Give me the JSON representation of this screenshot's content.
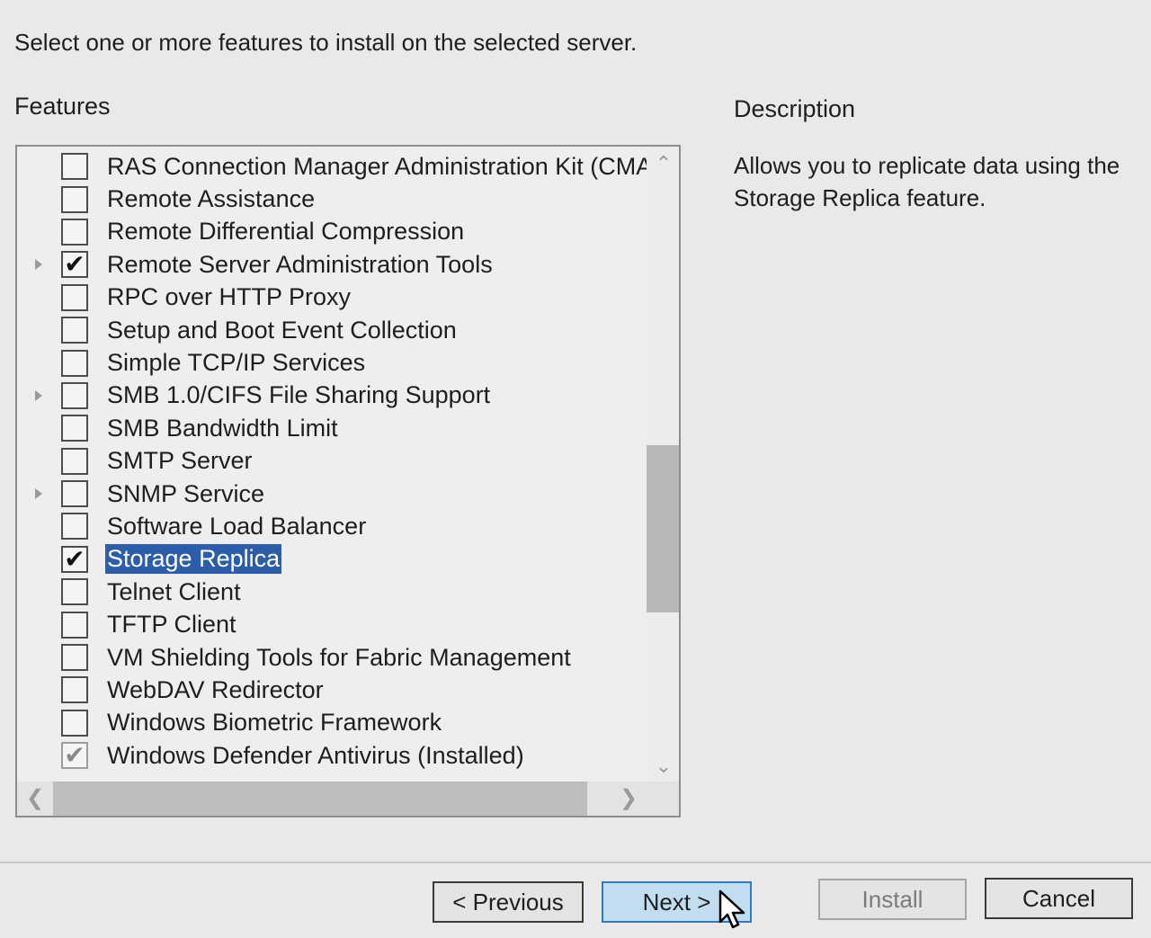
{
  "instruction": "Select one or more features to install on the selected server.",
  "features_label": "Features",
  "description": {
    "label": "Description",
    "text": "Allows you to replicate data using the Storage Replica feature."
  },
  "features": [
    {
      "label": "RAS Connection Manager Administration Kit (CMA",
      "checked": false,
      "expandable": false,
      "selected": false,
      "installed": false
    },
    {
      "label": "Remote Assistance",
      "checked": false,
      "expandable": false,
      "selected": false,
      "installed": false
    },
    {
      "label": "Remote Differential Compression",
      "checked": false,
      "expandable": false,
      "selected": false,
      "installed": false
    },
    {
      "label": "Remote Server Administration Tools",
      "checked": true,
      "expandable": true,
      "selected": false,
      "installed": false
    },
    {
      "label": "RPC over HTTP Proxy",
      "checked": false,
      "expandable": false,
      "selected": false,
      "installed": false
    },
    {
      "label": "Setup and Boot Event Collection",
      "checked": false,
      "expandable": false,
      "selected": false,
      "installed": false
    },
    {
      "label": "Simple TCP/IP Services",
      "checked": false,
      "expandable": false,
      "selected": false,
      "installed": false
    },
    {
      "label": "SMB 1.0/CIFS File Sharing Support",
      "checked": false,
      "expandable": true,
      "selected": false,
      "installed": false
    },
    {
      "label": "SMB Bandwidth Limit",
      "checked": false,
      "expandable": false,
      "selected": false,
      "installed": false
    },
    {
      "label": "SMTP Server",
      "checked": false,
      "expandable": false,
      "selected": false,
      "installed": false
    },
    {
      "label": "SNMP Service",
      "checked": false,
      "expandable": true,
      "selected": false,
      "installed": false
    },
    {
      "label": "Software Load Balancer",
      "checked": false,
      "expandable": false,
      "selected": false,
      "installed": false
    },
    {
      "label": "Storage Replica",
      "checked": true,
      "expandable": false,
      "selected": true,
      "installed": false
    },
    {
      "label": "Telnet Client",
      "checked": false,
      "expandable": false,
      "selected": false,
      "installed": false
    },
    {
      "label": "TFTP Client",
      "checked": false,
      "expandable": false,
      "selected": false,
      "installed": false
    },
    {
      "label": "VM Shielding Tools for Fabric Management",
      "checked": false,
      "expandable": false,
      "selected": false,
      "installed": false
    },
    {
      "label": "WebDAV Redirector",
      "checked": false,
      "expandable": false,
      "selected": false,
      "installed": false
    },
    {
      "label": "Windows Biometric Framework",
      "checked": false,
      "expandable": false,
      "selected": false,
      "installed": false
    },
    {
      "label": "Windows Defender Antivirus (Installed)",
      "checked": true,
      "expandable": false,
      "selected": false,
      "installed": true
    }
  ],
  "buttons": {
    "previous": "< Previous",
    "next": "Next >",
    "install": "Install",
    "cancel": "Cancel"
  },
  "icons": {
    "scroll_up": "chevron-up-icon",
    "scroll_down": "chevron-down-icon",
    "scroll_left": "chevron-left-icon",
    "scroll_right": "chevron-right-icon",
    "expand": "expand-triangle-icon",
    "cursor": "mouse-pointer-icon"
  },
  "colors": {
    "selection": "#2c5da8",
    "next_button": "#c2dcf0",
    "next_border": "#2a7ac4"
  }
}
